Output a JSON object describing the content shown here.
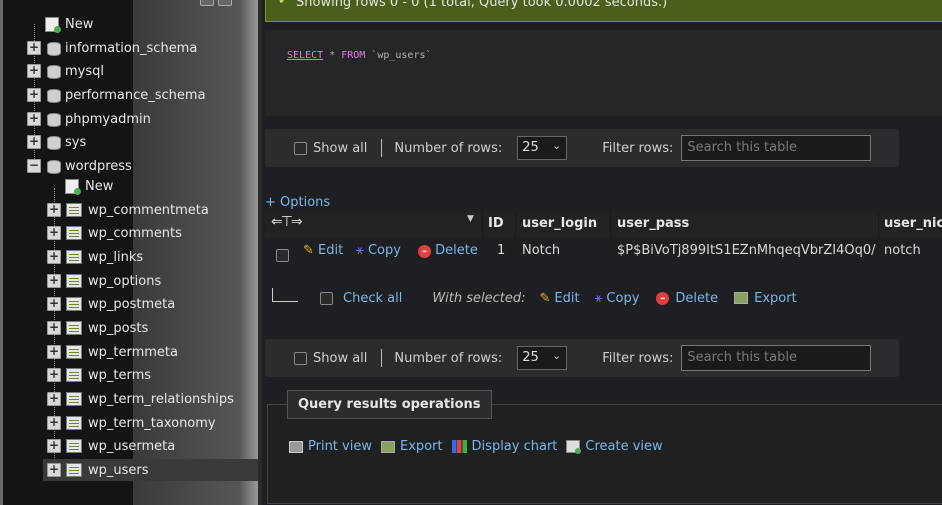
{
  "sidebar": {
    "nodes": [
      {
        "label": "New"
      },
      {
        "label": "information_schema"
      },
      {
        "label": "mysql"
      },
      {
        "label": "performance_schema"
      },
      {
        "label": "phpmyadmin"
      },
      {
        "label": "sys"
      },
      {
        "label": "wordpress"
      }
    ],
    "wordpress_children": [
      {
        "label": "New"
      },
      {
        "label": "wp_commentmeta"
      },
      {
        "label": "wp_comments"
      },
      {
        "label": "wp_links"
      },
      {
        "label": "wp_options"
      },
      {
        "label": "wp_postmeta"
      },
      {
        "label": "wp_posts"
      },
      {
        "label": "wp_termmeta"
      },
      {
        "label": "wp_terms"
      },
      {
        "label": "wp_term_relationships"
      },
      {
        "label": "wp_term_taxonomy"
      },
      {
        "label": "wp_usermeta"
      },
      {
        "label": "wp_users"
      }
    ]
  },
  "success": {
    "text": "Showing rows 0 - 0 (1 total, Query took 0.0002 seconds.)"
  },
  "sql": {
    "select": "SELECT",
    "star": " * ",
    "from": "FROM",
    "table": " `wp_users`"
  },
  "nav": {
    "show_all": "Show all",
    "number_of_rows": "Number of rows:",
    "rows_value": "25",
    "filter_rows": "Filter rows:",
    "search_placeholder": "Search this table"
  },
  "options_label": "+ Options",
  "table": {
    "headers": [
      "ID",
      "user_login",
      "user_pass",
      "user_nic"
    ],
    "row": {
      "edit": "Edit",
      "copy": "Copy",
      "delete": "Delete",
      "id": "1",
      "user_login": "Notch",
      "user_pass": "$P$BiVoTj899ItS1EZnMhqeqVbrZI4Oq0/",
      "user_nicename": "notch"
    }
  },
  "with_selected": {
    "check_all": "Check all",
    "label": "With selected:",
    "edit": "Edit",
    "copy": "Copy",
    "delete": "Delete",
    "export": "Export"
  },
  "query_ops": {
    "title": "Query results operations",
    "print_view": "Print view",
    "export": "Export",
    "display_chart": "Display chart",
    "create_view": "Create view"
  },
  "colors": {
    "link": "#7ab8e8",
    "success_bg": "#4a5f1a",
    "keyword": "#e07ae0"
  }
}
